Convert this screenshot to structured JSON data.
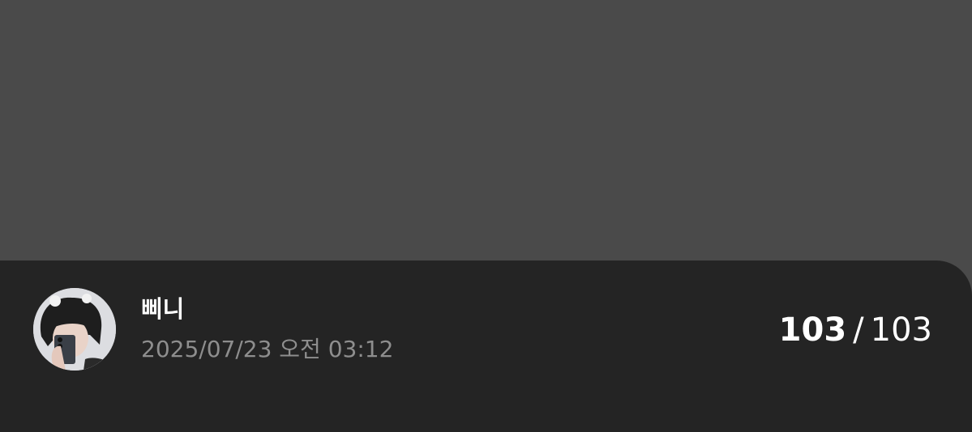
{
  "post": {
    "author_name": "삐니",
    "timestamp": "2025/07/23 오전 03:12",
    "avatar_icon": "profile-photo-icon"
  },
  "pager": {
    "current": "103",
    "separator": "/",
    "total": "103"
  },
  "colors": {
    "media_background": "#4a4a4a",
    "info_bar_background": "#242424",
    "primary_text": "#ffffff",
    "secondary_text": "#8e8e8e"
  }
}
